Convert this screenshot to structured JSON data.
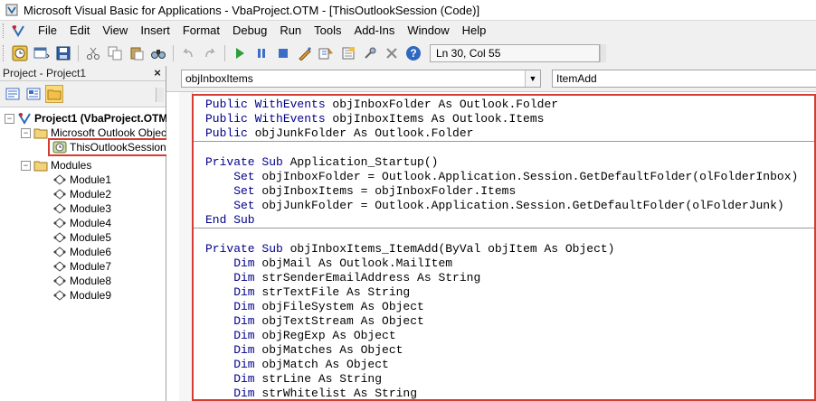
{
  "window": {
    "title": "Microsoft Visual Basic for Applications - VbaProject.OTM - [ThisOutlookSession (Code)]"
  },
  "menubar": {
    "items": [
      "File",
      "Edit",
      "View",
      "Insert",
      "Format",
      "Debug",
      "Run",
      "Tools",
      "Add-Ins",
      "Window",
      "Help"
    ]
  },
  "toolbar": {
    "icons": [
      "outlook-icon",
      "insert-module-icon",
      "save-icon",
      "cut-icon",
      "copy-icon",
      "paste-icon",
      "find-icon",
      "undo-icon",
      "redo-icon",
      "run-icon",
      "break-icon",
      "reset-icon",
      "design-mode-icon",
      "project-explorer-icon",
      "properties-icon",
      "object-browser-icon",
      "toolbox-icon",
      "help-icon"
    ],
    "position": "Ln 30, Col 55"
  },
  "project_panel": {
    "title": "Project - Project1",
    "close": "×",
    "tree": {
      "project": "Project1 (VbaProject.OTM",
      "outlook_objects": "Microsoft Outlook Objects",
      "session": "ThisOutlookSession",
      "modules_folder": "Modules",
      "modules": [
        "Module1",
        "Module2",
        "Module3",
        "Module4",
        "Module5",
        "Module6",
        "Module7",
        "Module8",
        "Module9"
      ]
    }
  },
  "code_window": {
    "object_combo": "objInboxItems",
    "procedure_combo": "ItemAdd",
    "lines": [
      {
        "kw": "Public WithEvents",
        "rest": " objInboxFolder As Outlook.Folder"
      },
      {
        "kw": "Public WithEvents",
        "rest": " objInboxItems As Outlook.Items"
      },
      {
        "kw": "Public",
        "rest": " objJunkFolder As Outlook.Folder"
      },
      {
        "kw": "",
        "rest": ""
      },
      {
        "kw": "Private Sub",
        "rest": " Application_Startup()"
      },
      {
        "kw": "    Set",
        "rest": " objInboxFolder = Outlook.Application.Session.GetDefaultFolder(olFolderInbox)"
      },
      {
        "kw": "    Set",
        "rest": " objInboxItems = objInboxFolder.Items"
      },
      {
        "kw": "    Set",
        "rest": " objJunkFolder = Outlook.Application.Session.GetDefaultFolder(olFolderJunk)"
      },
      {
        "kw": "End Sub",
        "rest": ""
      },
      {
        "kw": "",
        "rest": ""
      },
      {
        "kw": "Private Sub",
        "rest": " objInboxItems_ItemAdd(ByVal objItem As Object)"
      },
      {
        "kw": "    Dim",
        "rest": " objMail As Outlook.MailItem"
      },
      {
        "kw": "    Dim",
        "rest": " strSenderEmailAddress As String"
      },
      {
        "kw": "    Dim",
        "rest": " strTextFile As String"
      },
      {
        "kw": "    Dim",
        "rest": " objFileSystem As Object"
      },
      {
        "kw": "    Dim",
        "rest": " objTextStream As Object"
      },
      {
        "kw": "    Dim",
        "rest": " objRegExp As Object"
      },
      {
        "kw": "    Dim",
        "rest": " objMatches As Object"
      },
      {
        "kw": "    Dim",
        "rest": " objMatch As Object"
      },
      {
        "kw": "    Dim",
        "rest": " strLine As String"
      },
      {
        "kw": "    Dim",
        "rest": " strWhitelist As String"
      }
    ]
  },
  "colors": {
    "highlight_border": "#d63b34",
    "keyword": "#00008b"
  }
}
